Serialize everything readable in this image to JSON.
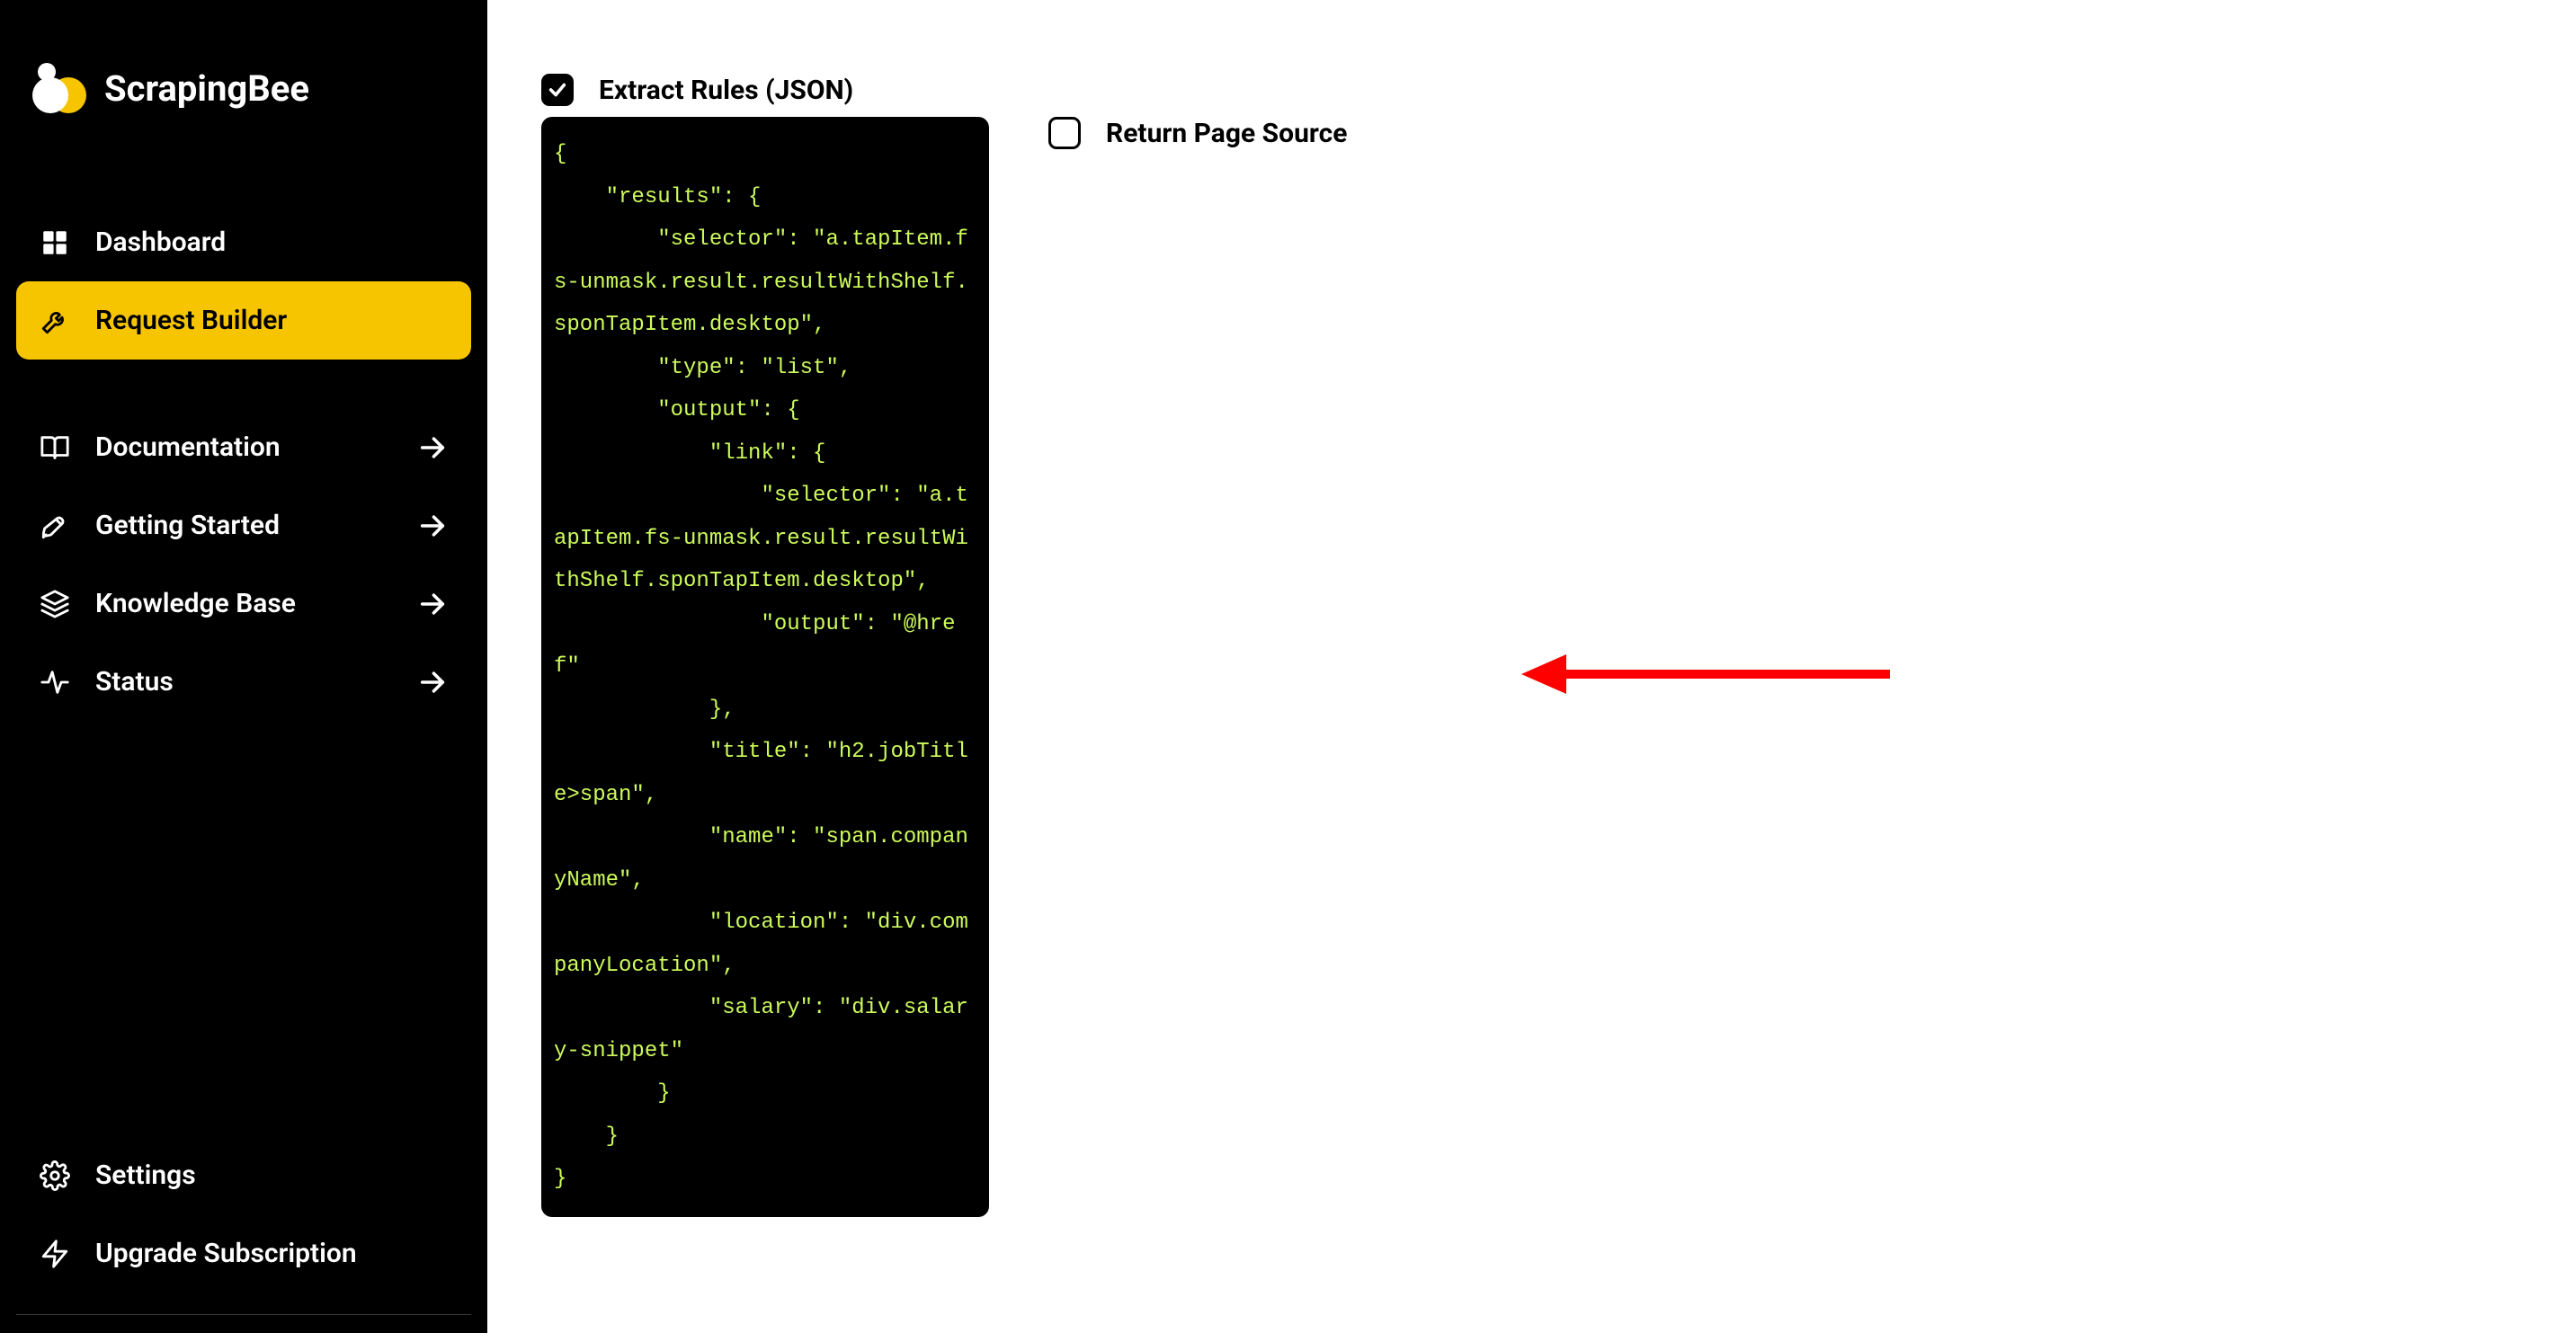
{
  "brand": {
    "name": "ScrapingBee"
  },
  "sidebar": {
    "items": [
      {
        "label": "Dashboard"
      },
      {
        "label": "Request Builder"
      },
      {
        "label": "Documentation"
      },
      {
        "label": "Getting Started"
      },
      {
        "label": "Knowledge Base"
      },
      {
        "label": "Status"
      }
    ],
    "bottom": [
      {
        "label": "Settings"
      },
      {
        "label": "Upgrade Subscription"
      }
    ]
  },
  "options": {
    "extract_rules_label": "Extract Rules (JSON)",
    "extract_rules_checked": true,
    "return_source_label": "Return Page Source",
    "return_source_checked": false
  },
  "code": "{\n    \"results\": {\n        \"selector\": \"a.tapItem.fs-unmask.result.resultWithShelf.sponTapItem.desktop\",\n        \"type\": \"list\",\n        \"output\": {\n            \"link\": {\n                \"selector\": \"a.tapItem.fs-unmask.result.resultWithShelf.sponTapItem.desktop\",\n                \"output\": \"@href\"\n            },\n            \"title\": \"h2.jobTitle>span\",\n            \"name\": \"span.companyName\",\n            \"location\": \"div.companyLocation\",\n            \"salary\": \"div.salary-snippet\"\n        }\n    }\n}",
  "annotation": {
    "arrow_color": "#ff0000"
  }
}
